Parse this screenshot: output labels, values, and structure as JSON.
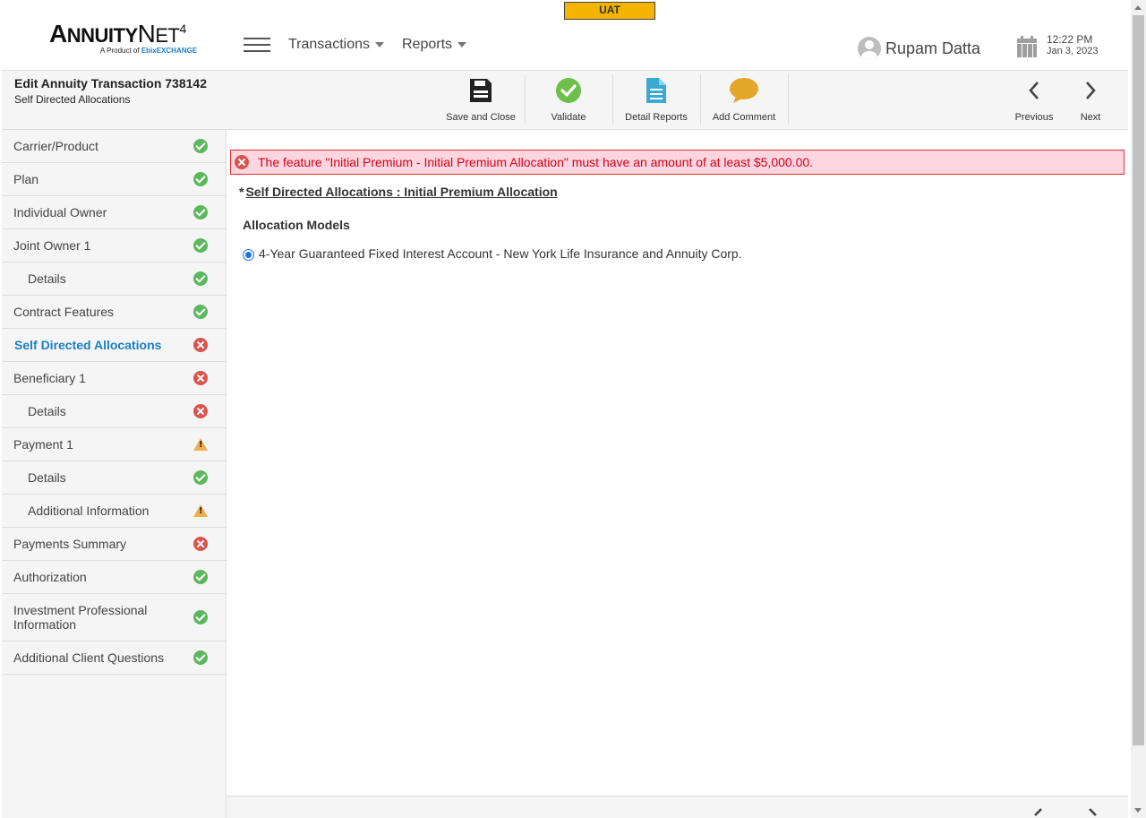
{
  "header": {
    "env_badge": "UAT",
    "logo": {
      "name_first": "A",
      "name_rest": "NNUITY",
      "name_net": "N",
      "name_net_rest": "ET",
      "version": "4",
      "tagline": "A Product of",
      "tagline_brand": "EbixEXCHANGE"
    },
    "nav": {
      "transactions_label": "Transactions",
      "reports_label": "Reports"
    },
    "user": {
      "name": "Rupam Datta",
      "icon": "user-avatar-icon"
    },
    "datetime": {
      "time": "12:22 PM",
      "date": "Jan 3, 2023",
      "icon": "calendar-icon"
    }
  },
  "toolbar": {
    "title": "Edit Annuity Transaction 738142",
    "subtitle": "Self Directed Allocations",
    "buttons": {
      "save_close": {
        "label": "Save and Close",
        "icon": "floppy-disk-icon"
      },
      "validate": {
        "label": "Validate",
        "icon": "check-circle-icon"
      },
      "detail_reports": {
        "label": "Detail Reports",
        "icon": "document-icon"
      },
      "add_comment": {
        "label": "Add Comment",
        "icon": "speech-bubble-icon"
      },
      "previous": {
        "label": "Previous",
        "icon": "chevron-left-icon"
      },
      "next": {
        "label": "Next",
        "icon": "chevron-right-icon"
      }
    }
  },
  "sidebar": {
    "items": [
      {
        "label": "Carrier/Product",
        "status": "ok"
      },
      {
        "label": "Plan",
        "status": "ok"
      },
      {
        "label": "Individual Owner",
        "status": "ok"
      },
      {
        "label": "Joint Owner 1",
        "status": "ok"
      },
      {
        "label": "Details",
        "status": "ok"
      },
      {
        "label": "Contract Features",
        "status": "ok"
      },
      {
        "label": "Self Directed Allocations",
        "status": "error"
      },
      {
        "label": "Beneficiary 1",
        "status": "error"
      },
      {
        "label": "Details",
        "status": "error"
      },
      {
        "label": "Payment 1",
        "status": "warning"
      },
      {
        "label": "Details",
        "status": "ok"
      },
      {
        "label": "Additional Information",
        "status": "warning"
      },
      {
        "label": "Payments Summary",
        "status": "error"
      },
      {
        "label": "Authorization",
        "status": "ok"
      },
      {
        "label": "Investment Professional Information",
        "status": "ok"
      },
      {
        "label": "Additional Client Questions",
        "status": "ok"
      }
    ]
  },
  "main": {
    "alert": {
      "text": "The feature \"Initial Premium - Initial Premium Allocation\" must have an amount of at least $5,000.00.",
      "icon": "error-circle-icon"
    },
    "section_required_marker": "*",
    "section_title": "Self Directed Allocations : Initial Premium Allocation",
    "allocation_models_label": "Allocation Models",
    "allocation_option": {
      "label": "4-Year Guaranteed Fixed Interest Account - New York Life Insurance and Annuity Corp.",
      "selected": true
    }
  },
  "colors": {
    "accent": "#1a7fc9",
    "ok": "#5cb85c",
    "error": "#d9534f",
    "warning": "#f0ad4e",
    "alert_bg": "#ffd6e0",
    "alert_text": "#d0021b",
    "env_badge": "#f4b400"
  }
}
